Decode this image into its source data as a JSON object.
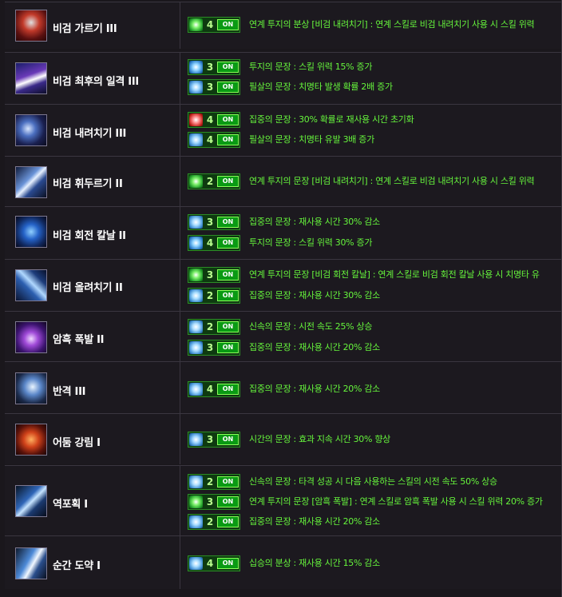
{
  "on_label": "ON",
  "colors": {
    "background": "#1c191f",
    "skill_name": "#ffffff",
    "rune_text": "#66f53c",
    "badge_border": "#2c8d26",
    "on_button": "#0a9a14"
  },
  "rows": [
    {
      "skill": "비검 가르기 III",
      "icon": "blade-cleave-icon",
      "runes": [
        {
          "icon": "chain-rune-icon",
          "level": "4",
          "text": "연계 투지의 분상 [비검 내려치기] : 연계 스킬로 비검 내려치기 사용 시 스킬 위력"
        }
      ]
    },
    {
      "skill": "비검 최후의 일격 III",
      "icon": "final-strike-icon",
      "runes": [
        {
          "icon": "power-rune-icon",
          "level": "3",
          "text": "투지의 문장 : 스킬 위력 15% 증가"
        },
        {
          "icon": "critical-rune-icon",
          "level": "3",
          "text": "필살의 문장 : 치명타 발생 확률 2배 증가"
        }
      ]
    },
    {
      "skill": "비검 내려치기 III",
      "icon": "downward-slash-icon",
      "runes": [
        {
          "icon": "reset-rune-icon",
          "level": "4",
          "text": "집중의 문장 : 30% 확률로 재사용 시간 초기화"
        },
        {
          "icon": "critical-rune-icon",
          "level": "4",
          "text": "필살의 문장 : 치명타 유발 3배 증가"
        }
      ]
    },
    {
      "skill": "비검 휘두르기 II",
      "icon": "sword-swing-icon",
      "runes": [
        {
          "icon": "chain-rune-icon",
          "level": "2",
          "text": "연계 투지의 문장 [비검 내려치기] : 연계 스킬로 비검 내려치기 사용 시 스킬 위력"
        }
      ]
    },
    {
      "skill": "비검 회전 칼날 II",
      "icon": "spinning-blade-icon",
      "runes": [
        {
          "icon": "cooldown-rune-icon",
          "level": "3",
          "text": "집중의 문장 : 재사용 시간 30% 감소"
        },
        {
          "icon": "power-rune-icon",
          "level": "4",
          "text": "투지의 문장 : 스킬 위력 30% 증가"
        }
      ]
    },
    {
      "skill": "비검 올려치기 II",
      "icon": "upward-slash-icon",
      "runes": [
        {
          "icon": "chain-rune-icon",
          "level": "3",
          "text": "연계 투지의 문장 [비검 회전 칼날] : 연계 스킬로 비검 회전 칼날 사용 시 치명타 유"
        },
        {
          "icon": "cooldown-rune-icon",
          "level": "2",
          "text": "집중의 문장 : 재사용 시간 30% 감소"
        }
      ]
    },
    {
      "skill": "암흑 폭발 II",
      "icon": "dark-explosion-icon",
      "runes": [
        {
          "icon": "speed-rune-icon",
          "level": "2",
          "text": "신속의 문장 : 시전 속도 25% 상승"
        },
        {
          "icon": "cooldown-rune-icon",
          "level": "3",
          "text": "집중의 문장 : 재사용 시간 20% 감소"
        }
      ]
    },
    {
      "skill": "반격 III",
      "icon": "counter-icon",
      "runes": [
        {
          "icon": "cooldown-rune-icon",
          "level": "4",
          "text": "집중의 문장 : 재사용 시간 20% 감소"
        }
      ]
    },
    {
      "skill": "어둠 강림 I",
      "icon": "dark-descent-icon",
      "runes": [
        {
          "icon": "duration-rune-icon",
          "level": "3",
          "text": "시간의 문장 : 효과 지속 시간 30% 향상"
        }
      ]
    },
    {
      "skill": "역포획 I",
      "icon": "reverse-capture-icon",
      "runes": [
        {
          "icon": "speed-rune-icon",
          "level": "2",
          "text": "신속의 문장 : 타격 성공 시 다음 사용하는 스킬의 시전 속도 50% 상승"
        },
        {
          "icon": "chain-rune-icon",
          "level": "3",
          "text": "연계 투지의 문장 [암흑 폭발] : 연계 스킬로 암흑 폭발 사용 시 스킬 위력 20% 증가"
        },
        {
          "icon": "cooldown-rune-icon",
          "level": "2",
          "text": "집중의 문장 : 재사용 시간 20% 감소"
        }
      ]
    },
    {
      "skill": "순간 도약 I",
      "icon": "instant-leap-icon",
      "runes": [
        {
          "icon": "cooldown-rune-icon",
          "level": "4",
          "text": "십승의 분상 : 재사용 시간 15% 감소"
        }
      ]
    }
  ]
}
